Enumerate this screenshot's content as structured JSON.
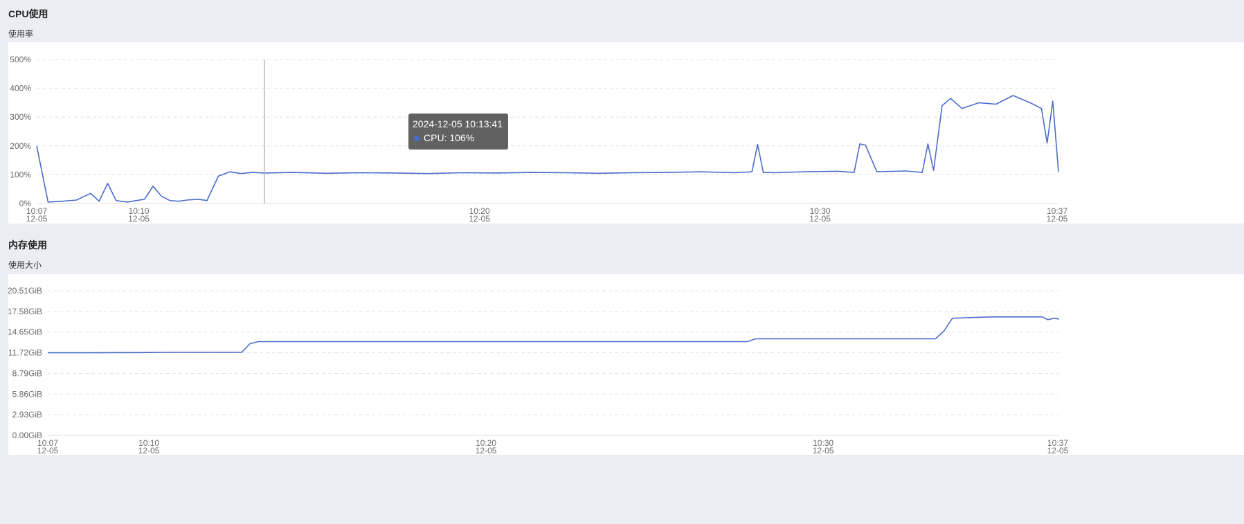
{
  "cpu": {
    "title": "CPU使用",
    "subtitle": "使用率",
    "y_ticks": [
      "0%",
      "100%",
      "200%",
      "300%",
      "400%",
      "500%"
    ],
    "x_ticks": [
      {
        "time": "10:07",
        "date": "12-05"
      },
      {
        "time": "10:10",
        "date": "12-05"
      },
      {
        "time": "10:20",
        "date": "12-05"
      },
      {
        "time": "10:30",
        "date": "12-05"
      },
      {
        "time": "10:37",
        "date": "12-05"
      }
    ],
    "tooltip": {
      "title": "2024-12-05 10:13:41",
      "label": "CPU: 106%",
      "color": "#4a6bca"
    }
  },
  "memory": {
    "title": "内存使用",
    "subtitle": "使用大小",
    "y_ticks": [
      "0.00GiB",
      "2.93GiB",
      "5.86GiB",
      "8.79GiB",
      "11.72GiB",
      "14.65GiB",
      "17.58GiB",
      "20.51GiB"
    ],
    "x_ticks": [
      {
        "time": "10:07",
        "date": "12-05"
      },
      {
        "time": "10:10",
        "date": "12-05"
      },
      {
        "time": "10:20",
        "date": "12-05"
      },
      {
        "time": "10:30",
        "date": "12-05"
      },
      {
        "time": "10:37",
        "date": "12-05"
      }
    ]
  },
  "chart_data": [
    {
      "type": "line",
      "title": "CPU使用",
      "ylabel": "使用率",
      "ylim": [
        0,
        500
      ],
      "y_unit": "%",
      "x_range": [
        "10:07",
        "10:37"
      ],
      "grid": true,
      "series": [
        {
          "x": [
            "10:07:00",
            "10:07:20",
            "10:07:45",
            "10:08:10",
            "10:08:35",
            "10:08:50",
            "10:09:05",
            "10:09:20",
            "10:09:40",
            "10:09:55",
            "10:10:10",
            "10:10:25",
            "10:10:40",
            "10:10:55",
            "10:11:10",
            "10:11:25",
            "10:11:45",
            "10:12:00",
            "10:12:20",
            "10:12:40",
            "10:13:00",
            "10:13:20",
            "10:13:41",
            "10:14:30",
            "10:15:30",
            "10:16:30",
            "10:17:30",
            "10:18:30",
            "10:19:30",
            "10:20:30",
            "10:21:30",
            "10:22:30",
            "10:23:30",
            "10:24:30",
            "10:25:30",
            "10:26:30",
            "10:27:30",
            "10:28:00",
            "10:28:10",
            "10:28:20",
            "10:28:40",
            "10:29:30",
            "10:30:30",
            "10:31:00",
            "10:31:10",
            "10:31:20",
            "10:31:40",
            "10:32:30",
            "10:33:00",
            "10:33:10",
            "10:33:20",
            "10:33:35",
            "10:33:50",
            "10:34:10",
            "10:34:40",
            "10:35:10",
            "10:35:40",
            "10:36:10",
            "10:36:30",
            "10:36:40",
            "10:36:50",
            "10:37:00"
          ],
          "y": [
            200,
            5,
            8,
            12,
            35,
            8,
            70,
            10,
            5,
            10,
            15,
            60,
            25,
            10,
            8,
            12,
            15,
            10,
            95,
            110,
            104,
            108,
            106,
            108,
            105,
            107,
            106,
            104,
            107,
            106,
            108,
            107,
            105,
            107,
            108,
            110,
            107,
            110,
            205,
            108,
            107,
            110,
            112,
            108,
            207,
            203,
            110,
            113,
            108,
            207,
            115,
            340,
            365,
            330,
            350,
            345,
            375,
            350,
            330,
            210,
            355,
            110
          ]
        }
      ]
    },
    {
      "type": "line",
      "title": "内存使用",
      "ylabel": "使用大小",
      "ylim": [
        0,
        20.51
      ],
      "y_unit": "GiB",
      "x_range": [
        "10:07",
        "10:37"
      ],
      "grid": true,
      "series": [
        {
          "x": [
            "10:07:00",
            "10:07:45",
            "10:09:50",
            "10:10:30",
            "10:12:45",
            "10:13:00",
            "10:13:15",
            "10:27:45",
            "10:28:00",
            "10:28:15",
            "10:33:20",
            "10:33:35",
            "10:33:50",
            "10:34:20",
            "10:35:00",
            "10:36:30",
            "10:36:40",
            "10:36:50",
            "10:37:00"
          ],
          "y": [
            11.72,
            11.72,
            11.75,
            11.78,
            11.78,
            13.0,
            13.3,
            13.3,
            13.7,
            13.7,
            13.7,
            14.8,
            16.6,
            16.7,
            16.8,
            16.8,
            16.4,
            16.6,
            16.5
          ]
        }
      ]
    }
  ]
}
